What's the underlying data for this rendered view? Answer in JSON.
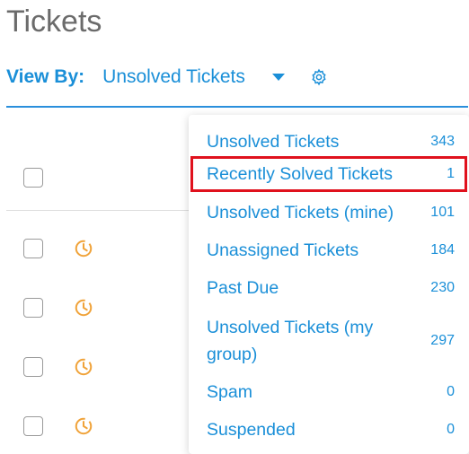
{
  "page": {
    "title": "Tickets"
  },
  "view_by": {
    "label": "View By:",
    "selected": "Unsolved Tickets",
    "caret_icon": "caret-down-icon",
    "settings_icon": "gear-icon"
  },
  "colors": {
    "accent": "#1a8fd8",
    "highlight": "#e0111d",
    "clock": "#f0a33a",
    "title": "#6b6b6b"
  },
  "rows": [
    {
      "status_icon": "clock-icon"
    },
    {
      "status_icon": "clock-icon"
    },
    {
      "status_icon": "clock-icon"
    },
    {
      "status_icon": "clock-icon"
    }
  ],
  "dropdown": {
    "items": [
      {
        "label": "Unsolved Tickets",
        "count": "343"
      },
      {
        "label": "Recently Solved Tickets",
        "count": "1"
      },
      {
        "label": "Unsolved Tickets (mine)",
        "count": "101"
      },
      {
        "label": "Unassigned Tickets",
        "count": "184"
      },
      {
        "label": "Past Due",
        "count": "230"
      },
      {
        "label": "Unsolved Tickets (my group)",
        "count": "297"
      },
      {
        "label": "Spam",
        "count": "0"
      },
      {
        "label": "Suspended",
        "count": "0"
      }
    ]
  }
}
